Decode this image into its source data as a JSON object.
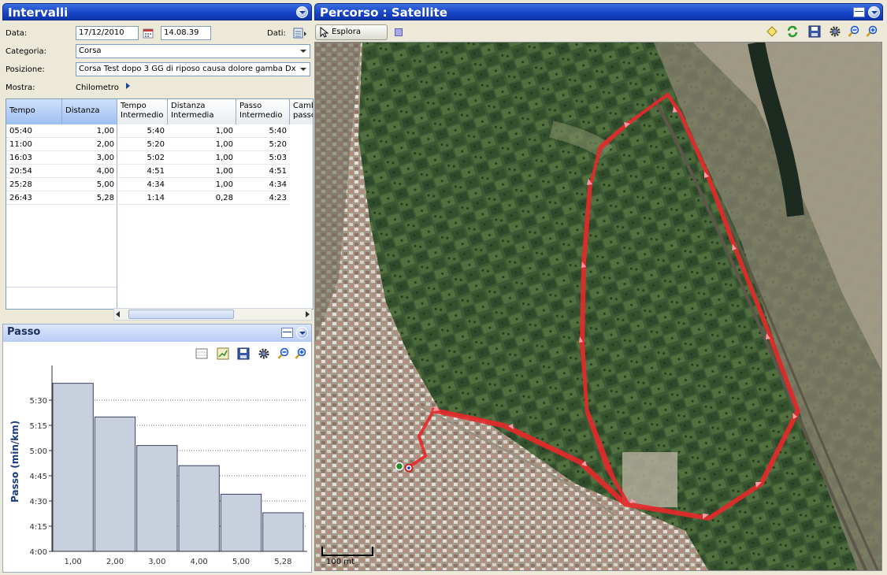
{
  "intervalli": {
    "title": "Intervalli",
    "data_label": "Data:",
    "date_value": "17/12/2010",
    "time_value": "14.08.39",
    "dati_label": "Dati:",
    "categoria_label": "Categoria:",
    "categoria_value": "Corsa",
    "posizione_label": "Posizione:",
    "posizione_value": "Corsa Test dopo 3 GG di riposo causa dolore gamba Dx",
    "mostra_label": "Mostra:",
    "mostra_value": "Chilometro",
    "columns": [
      "Tempo",
      "Distanza",
      "Tempo Intermedio",
      "Distanza Intermedia",
      "Passo Intermedio",
      "Camb passo"
    ],
    "rows": [
      [
        "05:40",
        "1,00",
        "5:40",
        "1,00",
        "5:40"
      ],
      [
        "11:00",
        "2,00",
        "5:20",
        "1,00",
        "5:20"
      ],
      [
        "16:03",
        "3,00",
        "5:02",
        "1,00",
        "5:03"
      ],
      [
        "20:54",
        "4,00",
        "4:51",
        "1,00",
        "4:51"
      ],
      [
        "25:28",
        "5,00",
        "4:34",
        "1,00",
        "4:34"
      ],
      [
        "26:43",
        "5,28",
        "1:14",
        "0,28",
        "4:23"
      ]
    ]
  },
  "passo": {
    "title": "Passo",
    "ylabel": "Passo (min/km)"
  },
  "chart_data": {
    "type": "bar",
    "title": "",
    "ylabel": "Passo (min/km)",
    "categories": [
      "1,00",
      "2,00",
      "3,00",
      "4,00",
      "5,00",
      "5,28"
    ],
    "values": [
      5.667,
      5.333,
      5.05,
      4.85,
      4.567,
      4.383
    ],
    "ylim": [
      4.0,
      5.75
    ],
    "yticks": [
      "4:00",
      "4:15",
      "4:30",
      "4:45",
      "5:00",
      "5:15",
      "5:30"
    ],
    "grid": true,
    "bar_color": "#c9d0dd"
  },
  "percorso": {
    "title": "Percorso  : Satellite",
    "esplora_label": "Esplora",
    "scale_label": "100 mt"
  },
  "colors": {
    "header_blue": "#1746c9",
    "route_red": "#e8282a"
  }
}
